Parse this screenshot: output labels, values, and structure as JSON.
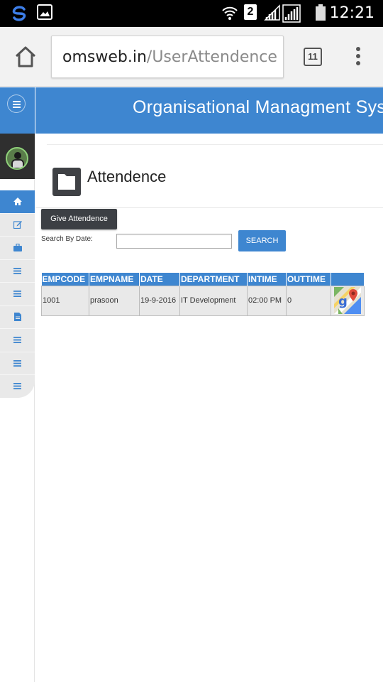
{
  "status_bar": {
    "time": "12:21",
    "sim_slot": "2"
  },
  "browser": {
    "url_host": "omsweb.in",
    "url_path": "/UserAttendence",
    "tab_count": "11"
  },
  "header": {
    "title": "Organisational Managment System"
  },
  "sidebar": {
    "items": [
      {
        "icon": "home-icon",
        "active": true
      },
      {
        "icon": "edit-icon",
        "active": false
      },
      {
        "icon": "briefcase-icon",
        "active": false
      },
      {
        "icon": "list-icon",
        "active": false
      },
      {
        "icon": "list-icon",
        "active": false
      },
      {
        "icon": "document-icon",
        "active": false
      },
      {
        "icon": "list-icon",
        "active": false
      },
      {
        "icon": "list-icon",
        "active": false
      },
      {
        "icon": "list-icon",
        "active": false
      }
    ]
  },
  "main": {
    "page_title": "Attendence",
    "give_button": "Give Attendence",
    "search_label": "Search By Date:",
    "search_value": "",
    "search_button": "SEARCH",
    "table": {
      "headers": [
        "EMPCODE",
        "EMPNAME",
        "DATE",
        "DEPARTMENT",
        "INTIME",
        "OUTTIME",
        ""
      ],
      "rows": [
        {
          "empcode": "1001",
          "empname": "prasoon",
          "date": "19-9-2016",
          "department": "IT Development",
          "intime": "02:00 PM",
          "outtime": "0",
          "map_icon": "google-maps-icon"
        }
      ]
    }
  },
  "colors": {
    "primary": "#3e86d0",
    "dark_button": "#3c3f44",
    "sidebar_bg": "#e9e9e9"
  }
}
